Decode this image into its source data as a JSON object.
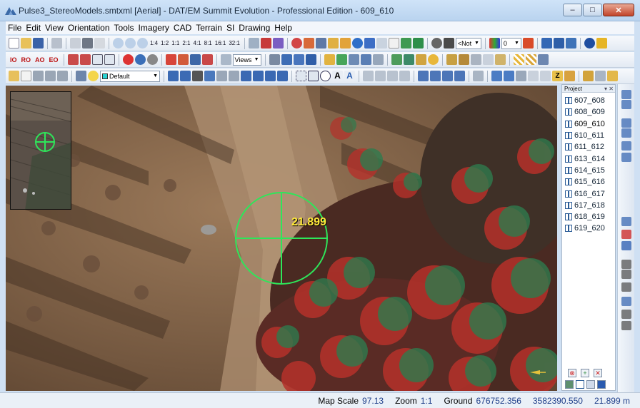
{
  "window": {
    "title": "Pulse3_StereoModels.smtxml [Aerial] - DAT/EM Summit Evolution - Professional Edition - 609_610",
    "minimize": "–",
    "maximize": "□",
    "close": "✕"
  },
  "menu": [
    "File",
    "Edit",
    "View",
    "Orientation",
    "Tools",
    "Imagery",
    "CAD",
    "Terrain",
    "SI",
    "Drawing",
    "Help"
  ],
  "toolbar": {
    "zoom_levels": [
      "1:4",
      "1:2",
      "1:1",
      "2:1",
      "4:1",
      "8:1",
      "16:1",
      "32:1"
    ],
    "orientation_buttons": [
      "IO",
      "RO",
      "AO",
      "EO"
    ],
    "not_combo": "<Not",
    "zero_combo": "0",
    "views_combo": "Views",
    "layer_combo": "Default"
  },
  "viewport": {
    "elevation_readout": "21.899"
  },
  "project": {
    "header": "Project",
    "selected_index": 2,
    "models": [
      "607_608",
      "608_609",
      "609_610",
      "610_611",
      "611_612",
      "613_614",
      "614_615",
      "615_616",
      "616_617",
      "617_618",
      "618_619",
      "619_620"
    ]
  },
  "status": {
    "map_scale_label": "Map Scale",
    "map_scale_value": "97.13",
    "zoom_label": "Zoom",
    "zoom_value": "1:1",
    "ground_label": "Ground",
    "ground_x": "676752.356",
    "ground_y": "3582390.550",
    "ground_z": "21.899 m"
  },
  "colors": {
    "cursor": "#2ee65a",
    "readout": "#ffe93a",
    "soil": "#8a6a4e",
    "vegetation_red": "#b5312a",
    "vegetation_green": "#2f7a4d"
  }
}
